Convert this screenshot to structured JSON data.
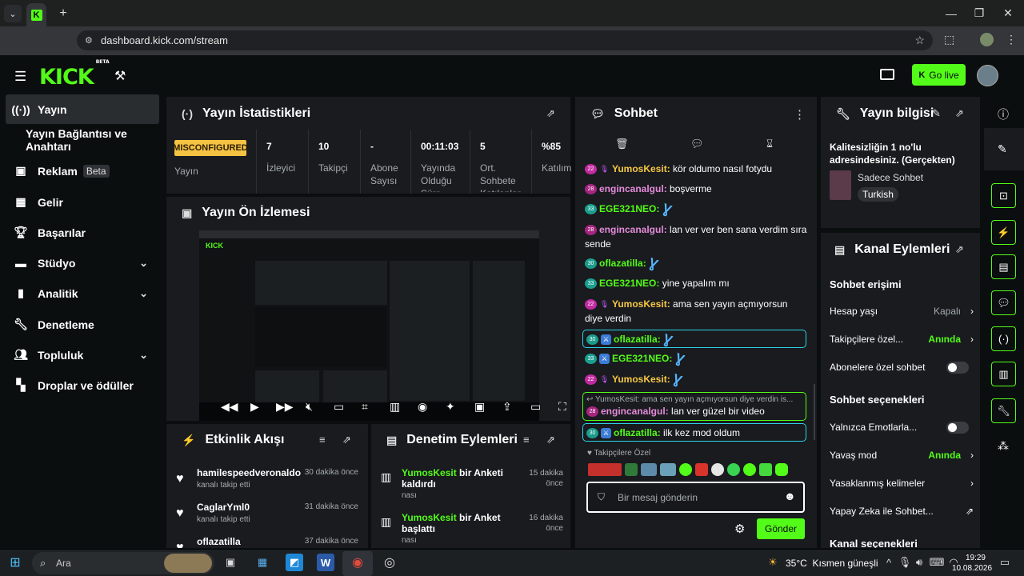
{
  "browser": {
    "url": "dashboard.kick.com/stream",
    "tab_icon": "kick-favicon"
  },
  "topbar": {
    "logo": "KICK",
    "logo_badge": "BETA",
    "go_live": "Go live"
  },
  "sidebar": {
    "items": [
      {
        "label": "Yayın",
        "icon": "broadcast-icon"
      },
      {
        "label": "Yayın Bağlantısı ve Anahtarı"
      },
      {
        "label": "Reklam",
        "badge": "Beta",
        "icon": "ad-icon"
      },
      {
        "label": "Gelir",
        "icon": "revenue-icon"
      },
      {
        "label": "Başarılar",
        "icon": "trophy-icon"
      },
      {
        "label": "Stüdyo",
        "icon": "studio-icon"
      },
      {
        "label": "Analitik",
        "icon": "analytics-icon"
      },
      {
        "label": "Denetleme",
        "icon": "wrench-icon"
      },
      {
        "label": "Topluluk",
        "icon": "community-icon"
      },
      {
        "label": "Droplar ve ödüller",
        "icon": "drops-icon"
      }
    ]
  },
  "stats": {
    "title": "Yayın İstatistikleri",
    "status_badge": "MISCONFIGURED",
    "status_label": "Yayın",
    "items": [
      {
        "value": "7",
        "label": "İzleyici"
      },
      {
        "value": "10",
        "label": "Takipçi"
      },
      {
        "value": "-",
        "label": "Abone Sayısı"
      },
      {
        "value": "00:11:03",
        "label": "Yayında Olduğu Süre"
      },
      {
        "value": "5",
        "label": "Ort. Sohbete Katılanlar"
      },
      {
        "value": "%85",
        "label": "Katılım"
      }
    ]
  },
  "preview": {
    "title": "Yayın Ön İzlemesi"
  },
  "activity": {
    "title": "Etkinlik Akışı",
    "items": [
      {
        "name": "hamilespeedveronaldo",
        "sub": "kanalı takip etti",
        "time": "30 dakika önce"
      },
      {
        "name": "CaglarYml0",
        "sub": "kanalı takip etti",
        "time": "31 dakika önce"
      },
      {
        "name": "oflazatilla",
        "sub": "",
        "time": "37 dakika önce"
      }
    ]
  },
  "modlog": {
    "title": "Denetim Eylemleri",
    "items": [
      {
        "user": "YumosKesit",
        "action": " bir Anketi kaldırdı",
        "sub": "nası",
        "time1": "15 dakika",
        "time2": "önce"
      },
      {
        "user": "YumosKesit",
        "action": " bir Anket başlattı",
        "sub": "nası",
        "time1": "16 dakika",
        "time2": "önce"
      }
    ]
  },
  "chat": {
    "title": "Sohbet",
    "messages": [
      {
        "level": "22",
        "user": "YumosKesit",
        "text": " kör oldumo nasıl fotydu"
      },
      {
        "level": "28",
        "user": "engincanalgul",
        "text": " boşverme"
      },
      {
        "level": "33",
        "user": "EGE321NEO",
        "text": ""
      },
      {
        "level": "28",
        "user": "engincanalgul",
        "text": " lan ver ver ben sana verdim sıra sende"
      },
      {
        "level": "30",
        "user": "oflazatilla",
        "text": ""
      },
      {
        "level": "33",
        "user": "EGE321NEO",
        "text": " yine yapalım mı"
      },
      {
        "level": "22",
        "user": "YumosKesit",
        "text": " ama sen yayın açmıyorsun diye verdin"
      },
      {
        "level": "30",
        "user": "oflazatilla",
        "text": ""
      },
      {
        "level": "33",
        "user": "EGE321NEO",
        "text": ""
      },
      {
        "level": "22",
        "user": "YumosKesit",
        "text": ""
      },
      {
        "reply_to": "YumosKesit: ama sen yayın açmıyorsun diye verdin is...",
        "level": "28",
        "user": "engincanalgul",
        "text": " lan ver güzel bir video"
      },
      {
        "level": "30",
        "user": "oflazatilla",
        "text": " ilk kez mod oldum"
      }
    ],
    "followers_only": "Takipçilere Özel",
    "input_placeholder": "Bir mesaj gönderin",
    "send": "Gönder"
  },
  "info": {
    "title": "Yayın bilgisi",
    "stream_title": "Kalitesizliğin 1 no'lu adresindesiniz. (Gerçekten)",
    "category": "Sadece Sohbet",
    "language": "Turkish"
  },
  "channel_actions": {
    "title": "Kanal Eylemleri",
    "chat_access_heading": "Sohbet erişimi",
    "account_age": "Hesap yaşı",
    "account_age_value": "Kapalı",
    "followers_only": "Takipçilere özel...",
    "followers_only_value": "Anında",
    "subscribers_only": "Abonelere özel sohbet",
    "chat_options_heading": "Sohbet seçenekleri",
    "emotes_only": "Yalnızca Emotlarla...",
    "slow_mode": "Yavaş mod",
    "slow_mode_value": "Anında",
    "banned_words": "Yasaklanmış kelimeler",
    "ai_chat": "Yapay Zeka ile Sohbet...",
    "channel_options_heading": "Kanal seçenekleri"
  },
  "taskbar": {
    "search": "Ara",
    "weather": "35°C",
    "weather_text": "Kısmen güneşli",
    "time": "19:29",
    "date": "10.08.2026"
  },
  "colors": {
    "accent": "#53fc18",
    "panel": "#191b1f",
    "background": "#0b0e0f",
    "warning": "#f6c244"
  }
}
